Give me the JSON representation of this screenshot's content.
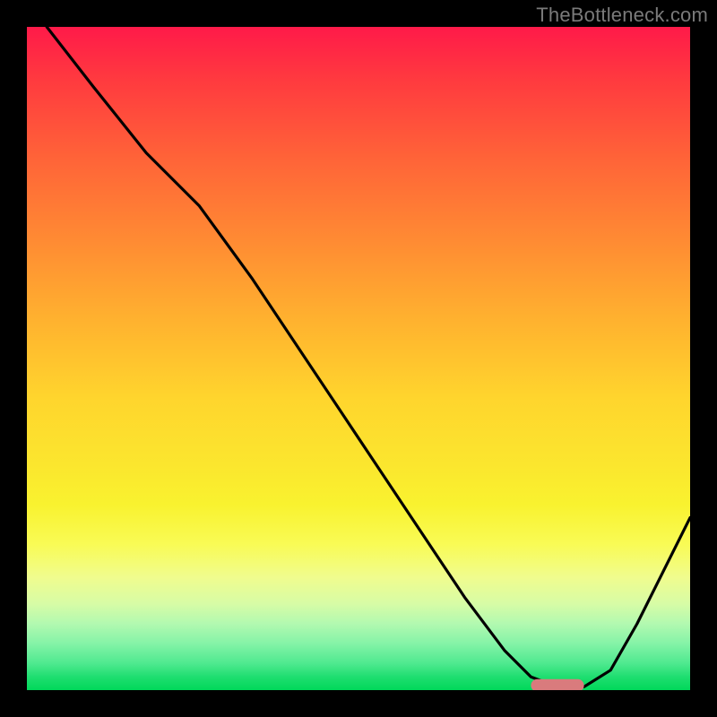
{
  "watermark": "TheBottleneck.com",
  "chart_data": {
    "type": "line",
    "title": "",
    "xlabel": "",
    "ylabel": "",
    "xlim": [
      0,
      100
    ],
    "ylim": [
      0,
      100
    ],
    "grid": false,
    "legend": false,
    "series": [
      {
        "name": "bottleneck-curve",
        "x": [
          3,
          10,
          18,
          26,
          34,
          42,
          50,
          58,
          66,
          72,
          76,
          80,
          84,
          88,
          92,
          96,
          100
        ],
        "y": [
          100,
          91,
          81,
          73,
          62,
          50,
          38,
          26,
          14,
          6,
          2,
          0.5,
          0.5,
          3,
          10,
          18,
          26
        ]
      }
    ],
    "marker": {
      "name": "optimal-point",
      "x_range": [
        76,
        84
      ],
      "y": 0.7,
      "color": "#d97b7d",
      "shape": "rounded-bar"
    },
    "gradient_stops": [
      {
        "pos": 0.0,
        "color": "#ff1a49"
      },
      {
        "pos": 0.32,
        "color": "#ff8a33"
      },
      {
        "pos": 0.56,
        "color": "#ffd52d"
      },
      {
        "pos": 0.78,
        "color": "#f9fb55"
      },
      {
        "pos": 0.9,
        "color": "#b2f9b0"
      },
      {
        "pos": 1.0,
        "color": "#00d85a"
      }
    ]
  }
}
